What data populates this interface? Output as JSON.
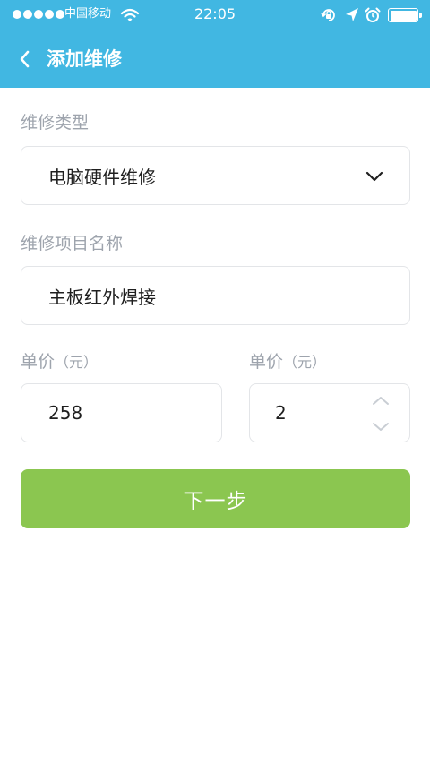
{
  "status_bar": {
    "carrier": "中国移动",
    "time": "22:05",
    "signal_icon": "signal-dots-icon",
    "wifi_icon": "wifi-icon",
    "lock_icon": "orientation-lock-icon",
    "location_icon": "location-arrow-icon",
    "alarm_icon": "alarm-clock-icon",
    "battery_icon": "battery-icon",
    "battery_level": 1.0
  },
  "nav": {
    "back_icon": "chevron-left-icon",
    "title": "添加维修"
  },
  "form": {
    "repair_type": {
      "label": "维修类型",
      "value": "电脑硬件维修",
      "icon": "chevron-down-icon"
    },
    "item_name": {
      "label": "维修项目名称",
      "value": "主板红外焊接"
    },
    "unit_price": {
      "label": "单价",
      "unit": "（元）",
      "value": "258"
    },
    "quantity": {
      "label": "单价",
      "unit": "（元）",
      "value": "2",
      "up_icon": "chevron-up-icon",
      "down_icon": "chevron-down-icon"
    }
  },
  "next_button": {
    "label": "下一步"
  },
  "colors": {
    "header": "#41b7e2",
    "button": "#8bc650",
    "label": "#9ea4ad",
    "border": "#e3e5e8"
  }
}
